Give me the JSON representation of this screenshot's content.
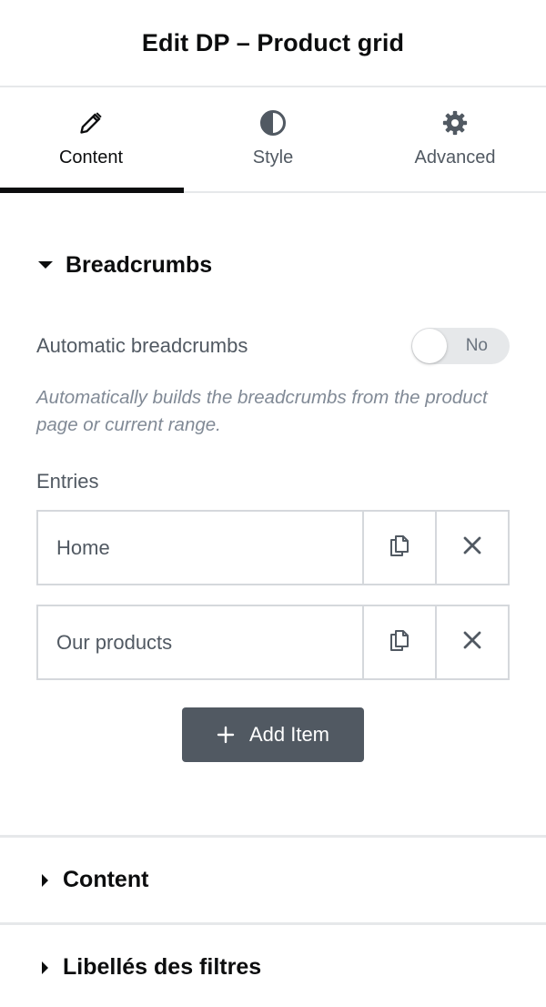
{
  "header": {
    "title": "Edit DP – Product grid"
  },
  "tabs": [
    {
      "label": "Content",
      "icon": "pencil-icon",
      "active": true
    },
    {
      "label": "Style",
      "icon": "contrast-icon",
      "active": false
    },
    {
      "label": "Advanced",
      "icon": "gear-icon",
      "active": false
    }
  ],
  "breadcrumbs": {
    "title": "Breadcrumbs",
    "automatic_label": "Automatic breadcrumbs",
    "switch_value": "No",
    "description": "Automatically builds the breadcrumbs from the product page or current range.",
    "entries_label": "Entries",
    "items": [
      {
        "label": "Home"
      },
      {
        "label": "Our products"
      }
    ],
    "add_label": "Add Item"
  },
  "sections": [
    {
      "title": "Content"
    },
    {
      "title": "Libellés des filtres"
    }
  ],
  "colors": {
    "text_dark": "#0c0d0e",
    "text_muted": "#515962",
    "button_bg": "#515962",
    "border": "#d5d8dc"
  }
}
